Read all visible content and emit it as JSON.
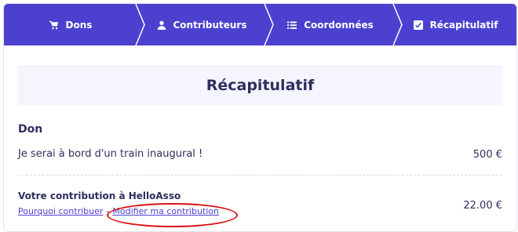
{
  "stepper": {
    "steps": [
      {
        "label": "Dons",
        "icon": "cart-icon"
      },
      {
        "label": "Contributeurs",
        "icon": "user-icon"
      },
      {
        "label": "Coordonnées",
        "icon": "list-icon"
      },
      {
        "label": "Récapitulatif",
        "icon": "checkbox-icon"
      }
    ],
    "color": "#4c40cf"
  },
  "summary": {
    "title": "Récapitulatif",
    "section_title": "Don",
    "donation": {
      "label": "Je serai à bord d'un train inaugural !",
      "amount": "500 €"
    },
    "contribution": {
      "label": "Votre contribution à HelloAsso",
      "why_link": "Pourquoi contribuer",
      "separator": "-",
      "modify_link": "Modifier ma contribution",
      "amount": "22.00 €"
    }
  },
  "colors": {
    "accent": "#4c40cf",
    "text": "#2e2f5e",
    "header_bg": "#f4f5fd",
    "annotation": "#d90e10"
  }
}
